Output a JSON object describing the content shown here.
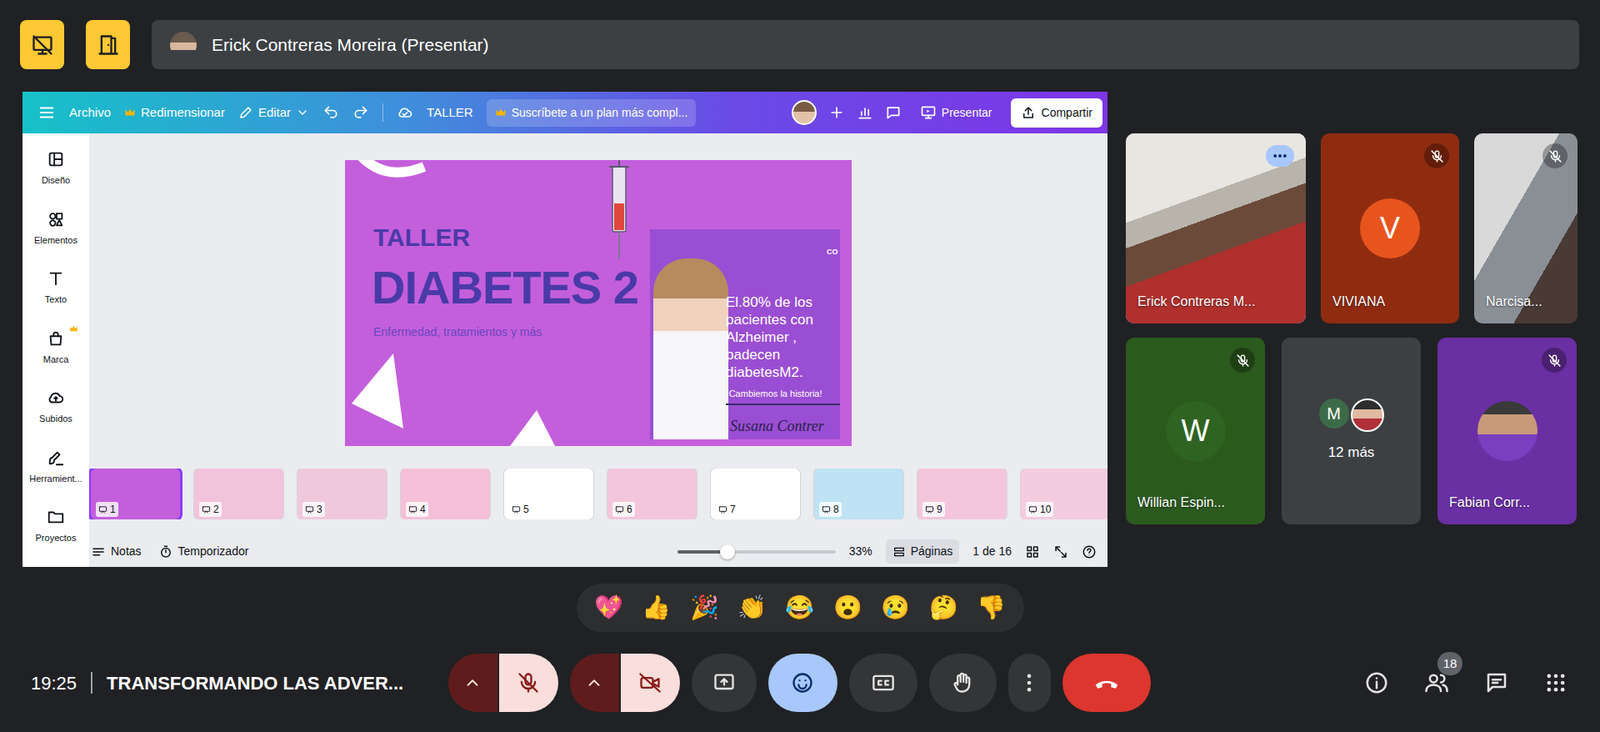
{
  "top_bar": {
    "presenter": "Erick Contreras Moreira (Presentar)"
  },
  "canva": {
    "menu": [
      {
        "label": "Archivo",
        "premium": false
      },
      {
        "label": "Redimensionar",
        "premium": true
      },
      {
        "label": "Editar",
        "premium": false
      }
    ],
    "doc_title": "TALLER",
    "promo": "Suscríbete a un plan más compl...",
    "present": "Presentar",
    "share": "Compartir",
    "sidebar": [
      {
        "label": "Diseño",
        "premium": false
      },
      {
        "label": "Elementos",
        "premium": false
      },
      {
        "label": "Texto",
        "premium": false
      },
      {
        "label": "Marca",
        "premium": true
      },
      {
        "label": "Subidos",
        "premium": false
      },
      {
        "label": "Herramient...",
        "premium": false
      },
      {
        "label": "Proyectos",
        "premium": false
      }
    ],
    "slide": {
      "kicker": "TALLER",
      "title": "DIABETES 2",
      "subtitle": "Enfermedad, tratamientos y más",
      "quote": "El.80% de los pacientes con Alzheimer , padecen diabetesM2.",
      "tagline": "¡Cambiemos la historia!",
      "signature": "Susana Contrer",
      "logo": "CO"
    },
    "thumbnails": [
      {
        "number": "1",
        "selected": true,
        "color": "#c45fdc"
      },
      {
        "number": "2",
        "selected": false,
        "color": "#f2c4dc"
      },
      {
        "number": "3",
        "selected": false,
        "color": "#f0c8dc"
      },
      {
        "number": "4",
        "selected": false,
        "color": "#f5c0d8"
      },
      {
        "number": "5",
        "selected": false,
        "color": "#ffffff"
      },
      {
        "number": "6",
        "selected": false,
        "color": "#f3c6dc"
      },
      {
        "number": "7",
        "selected": false,
        "color": "#ffffff"
      },
      {
        "number": "8",
        "selected": false,
        "color": "#bfe3f5"
      },
      {
        "number": "9",
        "selected": false,
        "color": "#f4c6dc"
      },
      {
        "number": "10",
        "selected": false,
        "color": "#f4cce0"
      }
    ],
    "footer": {
      "notes": "Notas",
      "timer": "Temporizador",
      "zoom": {
        "level": 0.32,
        "reading": "33%"
      },
      "pages": "Páginas",
      "page_count": "1 de 16"
    }
  },
  "participants": [
    {
      "name": "Erick Contreras M...",
      "kind": "video",
      "muted": false,
      "active_speaker": true
    },
    {
      "name": "VIVIANA",
      "kind": "initial",
      "muted": true,
      "active_speaker": false,
      "color": "#8f2c10",
      "avatar": {
        "initial": "V",
        "color": "#e8541e"
      }
    },
    {
      "name": "Narcisa...",
      "kind": "video",
      "muted": true,
      "active_speaker": false
    },
    {
      "name": "Willian Espin...",
      "kind": "initial",
      "muted": true,
      "active_speaker": false,
      "color": "#2b5a1e",
      "avatar": {
        "initial": "W",
        "color": "#2f6322"
      }
    },
    {
      "name": "12 más",
      "kind": "group",
      "color": "#3c4043",
      "avatars": [
        {
          "kind": "initial",
          "initial": "M",
          "color": "#3d6b4a"
        },
        {
          "kind": "photo"
        }
      ]
    },
    {
      "name": "Fabian Corr...",
      "kind": "photo",
      "muted": true,
      "active_speaker": false,
      "color": "#6a2fa3"
    }
  ],
  "reactions": [
    "💖",
    "👍",
    "🎉",
    "👏",
    "😂",
    "😮",
    "😢",
    "🤔",
    "👎"
  ],
  "bottom_bar": {
    "time": "19:25",
    "meeting": "TRANSFORMANDO LAS ADVER...",
    "controls": {
      "microphone": {
        "on": false
      },
      "camera": {
        "on": false
      },
      "reactions": {
        "selected": true
      },
      "captions": {
        "on": false
      },
      "raise_hand": {
        "on": false
      }
    },
    "people_count": "18"
  }
}
